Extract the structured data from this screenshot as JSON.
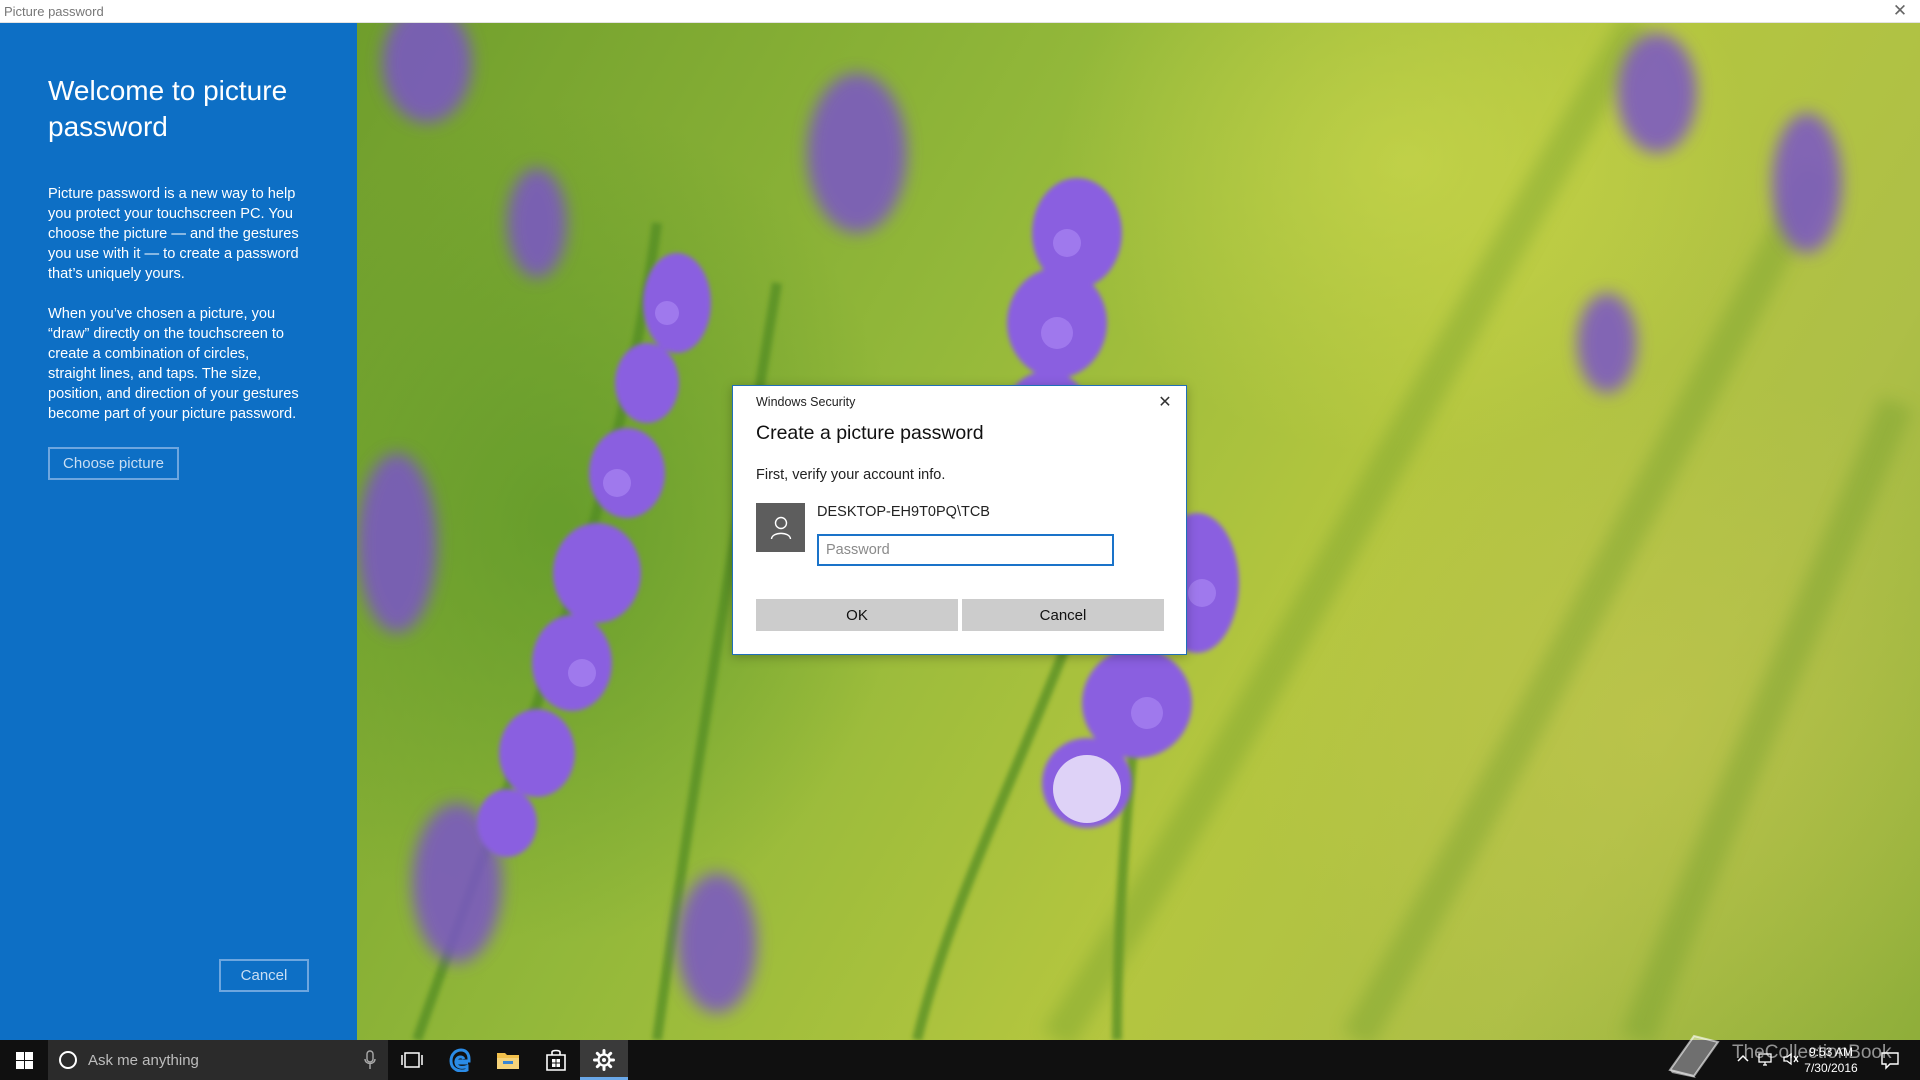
{
  "window": {
    "title": "Picture password"
  },
  "sidebar": {
    "title": "Welcome to picture password",
    "paragraph1": "Picture password is a new way to help you protect your touchscreen PC. You choose the picture — and the gestures you use with it — to create a password that’s uniquely yours.",
    "paragraph2": "When you’ve chosen a picture, you “draw” directly on the touchscreen to create a combination of circles, straight lines, and taps. The size, position, and direction of your gestures become part of your picture password.",
    "choose_label": "Choose picture",
    "cancel_label": "Cancel"
  },
  "dialog": {
    "caption": "Windows Security",
    "title": "Create a picture password",
    "subtitle": "First, verify your account info.",
    "account": "DESKTOP-EH9T0PQ\\TCB",
    "password_value": "",
    "password_placeholder": "Password",
    "ok_label": "OK",
    "cancel_label": "Cancel"
  },
  "taskbar": {
    "search_placeholder": "Ask me anything",
    "icons": [
      "start-icon",
      "cortana-icon",
      "microphone-icon",
      "task-view-icon",
      "edge-icon",
      "file-explorer-icon",
      "store-icon",
      "settings-icon"
    ],
    "active_icon": "settings-icon"
  },
  "tray": {
    "time": "9:53 AM",
    "date": "7/30/2016",
    "watermark": "TheCollectionBook"
  },
  "colors": {
    "sidebar": "#0d6fc5",
    "accent": "#1a73c9",
    "dialog_button": "#cccccc",
    "taskbar": "#101010"
  }
}
